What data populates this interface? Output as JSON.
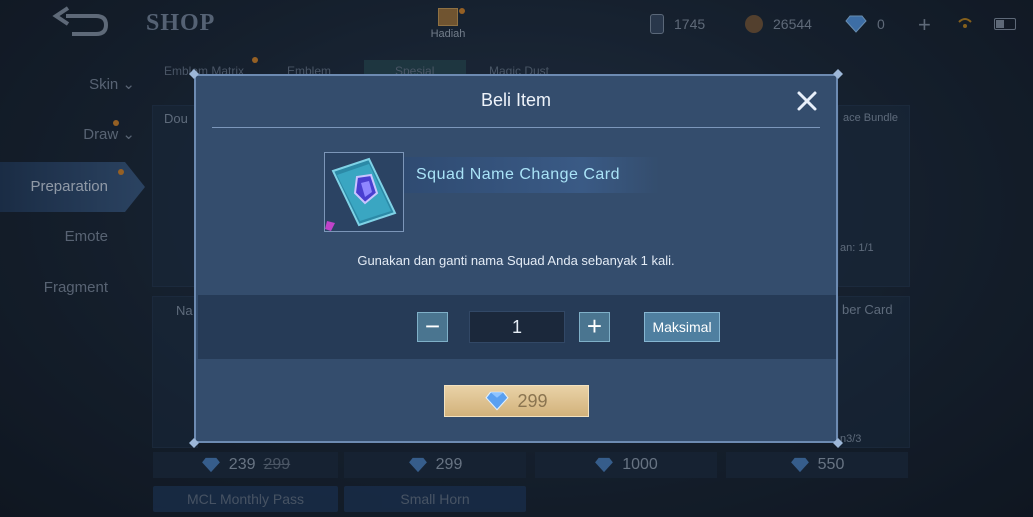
{
  "colors": {
    "accent": "#6d8bb2",
    "gem": "#5aa0f0",
    "buy_button": "#dcc28f",
    "active_tab": "#3e5e88"
  },
  "header": {
    "title": "SHOP",
    "gift_label": "Hadiah",
    "currencies": [
      {
        "icon": "ticket-icon",
        "value": "1745"
      },
      {
        "icon": "battle-point-icon",
        "value": "26544"
      },
      {
        "icon": "diamond-icon",
        "value": "0"
      }
    ]
  },
  "sidebar": {
    "items": [
      {
        "label": "Skin"
      },
      {
        "label": "Draw"
      },
      {
        "label": "Preparation",
        "active": true
      },
      {
        "label": "Emote"
      },
      {
        "label": "Fragment"
      }
    ]
  },
  "background": {
    "tabs": [
      "Emblem Matrix",
      "Emblem",
      "Spesial",
      "Magic Dust"
    ],
    "card_labels": [
      "Dou",
      "ace Bundle",
      "Na",
      "ber Card"
    ],
    "limits": [
      "an: 1/1",
      "n3/3"
    ],
    "prices": [
      {
        "value": "239",
        "old": "299"
      },
      {
        "value": "299"
      },
      {
        "value": "1000"
      },
      {
        "value": "550"
      }
    ],
    "bottom_items": [
      "MCL Monthly Pass",
      "Small Horn"
    ]
  },
  "modal": {
    "title": "Beli Item",
    "item_name": "Squad Name Change Card",
    "description": "Gunakan dan ganti nama Squad Anda sebanyak 1 kali.",
    "quantity": "1",
    "decrement": "−",
    "increment": "+",
    "max_label": "Maksimal",
    "price": "299"
  }
}
